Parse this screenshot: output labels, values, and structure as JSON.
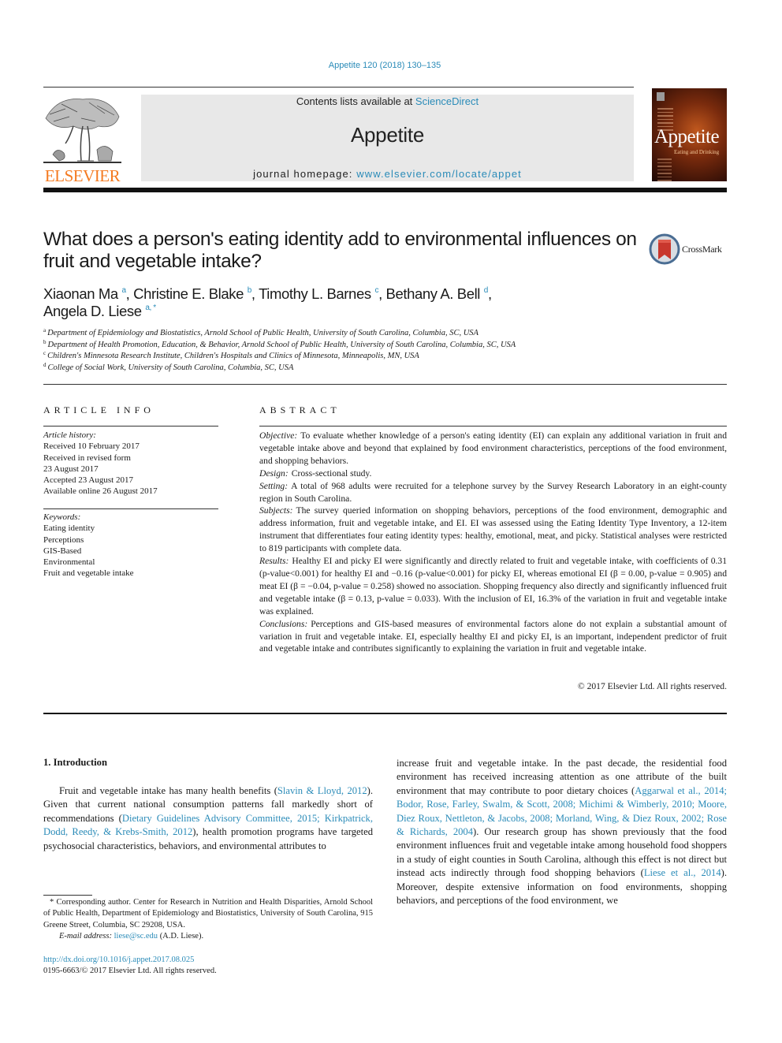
{
  "header": {
    "citation": "Appetite 120 (2018) 130–135",
    "contents_prefix": "Contents lists available at ",
    "contents_link": "ScienceDirect",
    "journal_name": "Appetite",
    "homepage_prefix": "journal homepage: ",
    "homepage_link": "www.elsevier.com/locate/appet",
    "publisher_wordmark": "ELSEVIER",
    "cover_title": "Appetite",
    "cover_subtitle": "Eating and Drinking",
    "crossmark_label": "CrossMark",
    "colors": {
      "link": "#2a8bb8",
      "elsevier_orange": "#f47a20"
    }
  },
  "article": {
    "title": "What does a person's eating identity add to environmental influences on fruit and vegetable intake?",
    "authors": [
      {
        "name": "Xiaonan Ma",
        "sup": "a",
        "sep": ", "
      },
      {
        "name": "Christine E. Blake",
        "sup": "b",
        "sep": ", "
      },
      {
        "name": "Timothy L. Barnes",
        "sup": "c",
        "sep": ", "
      },
      {
        "name": "Bethany A. Bell",
        "sup": "d",
        "sep": ","
      },
      {
        "name": "Angela D. Liese",
        "sup": "a, *",
        "sep": ""
      }
    ],
    "affiliations": [
      {
        "sup": "a",
        "text": "Department of Epidemiology and Biostatistics, Arnold School of Public Health, University of South Carolina, Columbia, SC, USA"
      },
      {
        "sup": "b",
        "text": "Department of Health Promotion, Education, & Behavior, Arnold School of Public Health, University of South Carolina, Columbia, SC, USA"
      },
      {
        "sup": "c",
        "text": "Children's Minnesota Research Institute, Children's Hospitals and Clinics of Minnesota, Minneapolis, MN, USA"
      },
      {
        "sup": "d",
        "text": "College of Social Work, University of South Carolina, Columbia, SC, USA"
      }
    ]
  },
  "article_info": {
    "heading": "ARTICLE INFO",
    "history_label": "Article history:",
    "history": [
      "Received 10 February 2017",
      "Received in revised form",
      "23 August 2017",
      "Accepted 23 August 2017",
      "Available online 26 August 2017"
    ],
    "keywords_label": "Keywords:",
    "keywords": [
      "Eating identity",
      "Perceptions",
      "GIS-Based",
      "Environmental",
      "Fruit and vegetable intake"
    ]
  },
  "abstract": {
    "heading": "ABSTRACT",
    "sections": [
      {
        "label": "Objective:",
        "text": "To evaluate whether knowledge of a person's eating identity (EI) can explain any additional variation in fruit and vegetable intake above and beyond that explained by food environment characteristics, perceptions of the food environment, and shopping behaviors."
      },
      {
        "label": "Design:",
        "text": "Cross-sectional study."
      },
      {
        "label": "Setting:",
        "text": "A total of 968 adults were recruited for a telephone survey by the Survey Research Laboratory in an eight-county region in South Carolina."
      },
      {
        "label": "Subjects:",
        "text": "The survey queried information on shopping behaviors, perceptions of the food environment, demographic and address information, fruit and vegetable intake, and EI. EI was assessed using the Eating Identity Type Inventory, a 12-item instrument that differentiates four eating identity types: healthy, emotional, meat, and picky. Statistical analyses were restricted to 819 participants with complete data."
      },
      {
        "label": "Results:",
        "text": "Healthy EI and picky EI were significantly and directly related to fruit and vegetable intake, with coefficients of 0.31 (p-value<0.001) for healthy EI and −0.16 (p-value<0.001) for picky EI, whereas emotional EI (β = 0.00, p-value = 0.905) and meat EI (β = −0.04, p-value = 0.258) showed no association. Shopping frequency also directly and significantly influenced fruit and vegetable intake (β = 0.13, p-value = 0.033). With the inclusion of EI, 16.3% of the variation in fruit and vegetable intake was explained."
      },
      {
        "label": "Conclusions:",
        "text": "Perceptions and GIS-based measures of environmental factors alone do not explain a substantial amount of variation in fruit and vegetable intake. EI, especially healthy EI and picky EI, is an important, independent predictor of fruit and vegetable intake and contributes significantly to explaining the variation in fruit and vegetable intake."
      }
    ],
    "copyright": "© 2017 Elsevier Ltd. All rights reserved."
  },
  "body": {
    "section_heading": "1.  Introduction",
    "left_paragraph": [
      {
        "t": "Fruit and vegetable intake has many health benefits ("
      },
      {
        "l": "Slavin & Lloyd, 2012"
      },
      {
        "t": "). Given that current national consumption patterns fall markedly short of recommendations ("
      },
      {
        "l": "Dietary Guidelines Advisory Committee, 2015; Kirkpatrick, Dodd, Reedy, & Krebs-Smith, 2012"
      },
      {
        "t": "), health promotion programs have targeted psychosocial characteristics, behaviors, and environmental attributes to"
      }
    ],
    "right_paragraph": [
      {
        "t": "increase fruit and vegetable intake. In the past decade, the residential food environment has received increasing attention as one attribute of the built environment that may contribute to poor dietary choices ("
      },
      {
        "l": "Aggarwal et al., 2014; Bodor, Rose, Farley, Swalm, & Scott, 2008; Michimi & Wimberly, 2010; Moore, Diez Roux, Nettleton, & Jacobs, 2008; Morland, Wing, & Diez Roux, 2002; Rose & Richards, 2004"
      },
      {
        "t": "). Our research group has shown previously that the food environment influences fruit and vegetable intake among household food shoppers in a study of eight counties in South Carolina, although this effect is not direct but instead acts indirectly through food shopping behaviors ("
      },
      {
        "l": "Liese et al., 2014"
      },
      {
        "t": "). Moreover, despite extensive information on food environments, shopping behaviors, and perceptions of the food environment, we"
      }
    ]
  },
  "footnotes": {
    "corresponding": "* Corresponding author. Center for Research in Nutrition and Health Disparities, Arnold School of Public Health, Department of Epidemiology and Biostatistics, University of South Carolina, 915 Greene Street, Columbia, SC 29208, USA.",
    "email_label": "E-mail address:",
    "email": "liese@sc.edu",
    "email_suffix": " (A.D. Liese).",
    "doi": "http://dx.doi.org/10.1016/j.appet.2017.08.025",
    "issn_line": "0195-6663/© 2017 Elsevier Ltd. All rights reserved."
  }
}
